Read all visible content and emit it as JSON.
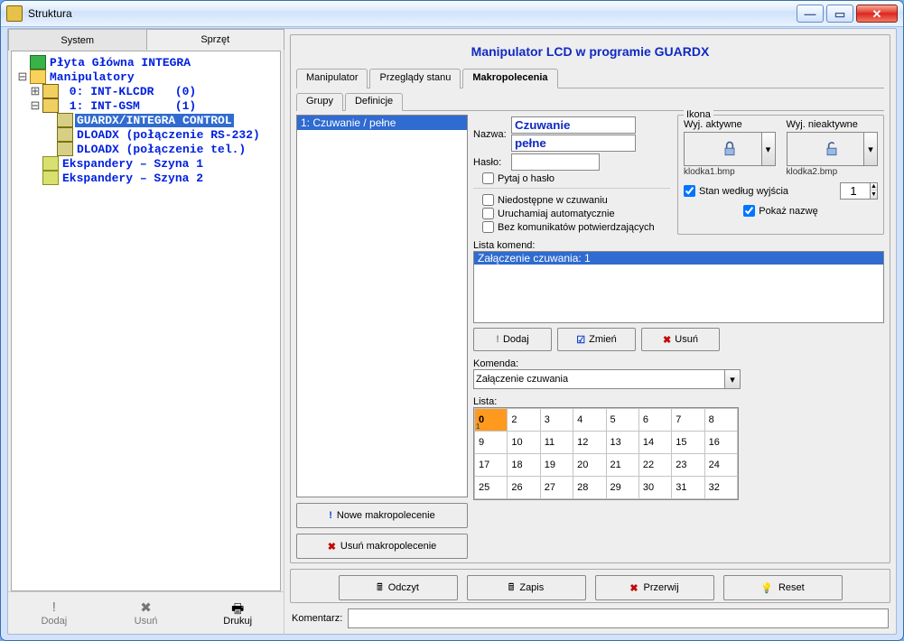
{
  "window": {
    "title": "Struktura"
  },
  "left_tabs": {
    "system": "System",
    "hardware": "Sprzęt",
    "active": "hardware"
  },
  "tree": {
    "root": "Płyta Główna INTEGRA",
    "manip": "Manipulatory",
    "kp0": " 0: INT-KLCDR   (0)",
    "kp1": " 1: INT-GSM     (1)",
    "guardx": "GUARDX/INTEGRA CONTROL",
    "dloadx_rs": "DLOADX (połączenie RS-232)",
    "dloadx_tel": "DLOADX (połączenie tel.)",
    "exp1": "Ekspandery – Szyna 1",
    "exp2": "Ekspandery – Szyna 2"
  },
  "left_buttons": {
    "add": "Dodaj",
    "del": "Usuń",
    "print": "Drukuj"
  },
  "panel_title": "Manipulator LCD w programie GUARDX",
  "main_tabs": {
    "t1": "Manipulator",
    "t2": "Przeglądy stanu",
    "t3": "Makropolecenia"
  },
  "sub_tabs": {
    "t1": "Grupy",
    "t2": "Definicje"
  },
  "def_list": {
    "item1": "1: Czuwanie /  pełne"
  },
  "def_buttons": {
    "new": "Nowe makropolecenie",
    "del": "Usuń makropolecenie"
  },
  "props": {
    "name_label": "Nazwa:",
    "name_line1": "Czuwanie",
    "name_line2": "pełne",
    "pass_label": "Hasło:",
    "pass_value": "",
    "cb_askpass": "Pytaj o hasło",
    "cb_unavail": "Niedostępne w czuwaniu",
    "cb_auto": "Uruchamiaj automatycznie",
    "cb_nocomm": "Bez komunikatów potwierdzających"
  },
  "ikona": {
    "legend": "Ikona",
    "active_label": "Wyj. aktywne",
    "inactive_label": "Wyj. nieaktywne",
    "file1": "klodka1.bmp",
    "file2": "klodka2.bmp",
    "state_check": "Stan według wyjścia",
    "state_value": "1",
    "show_name": "Pokaż nazwę"
  },
  "kom_list": {
    "header": "Lista komend:",
    "item": "Załączenie czuwania: 1"
  },
  "kom_buttons": {
    "add": "Dodaj",
    "edit": "Zmień",
    "del": "Usuń"
  },
  "komenda": {
    "label": "Komenda:",
    "value": "Załączenie czuwania"
  },
  "lista_label": "Lista:",
  "actions": {
    "read": "Odczyt",
    "write": "Zapis",
    "abort": "Przerwij",
    "reset": "Reset"
  },
  "comment": {
    "label": "Komentarz:",
    "value": ""
  },
  "chart_data": {
    "type": "table",
    "columns": 8,
    "rows": 4,
    "cells": [
      [
        "0",
        "2",
        "3",
        "4",
        "5",
        "6",
        "7",
        "8"
      ],
      [
        "9",
        "10",
        "11",
        "12",
        "13",
        "14",
        "15",
        "16"
      ],
      [
        "17",
        "18",
        "19",
        "20",
        "21",
        "22",
        "23",
        "24"
      ],
      [
        "25",
        "26",
        "27",
        "28",
        "29",
        "30",
        "31",
        "32"
      ]
    ],
    "corner_first_cell": "1",
    "selected": [
      0,
      0
    ]
  }
}
